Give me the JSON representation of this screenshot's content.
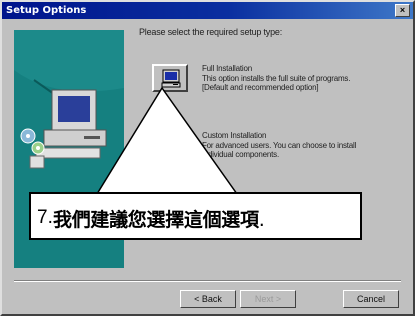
{
  "window": {
    "title": "Setup Options",
    "close_glyph": "×"
  },
  "prompt": "Please select the required setup type:",
  "options": [
    {
      "icon": "computer-monitor-icon",
      "title": "Full Installation",
      "line1": "This option installs the full suite of programs.",
      "line2": "[Default and recommended option]"
    },
    {
      "icon": "computer-monitor-icon",
      "title": "Custom Installation",
      "line1": "For advanced users. You can choose to install",
      "line2": "individual components."
    }
  ],
  "note": {
    "number": "7.",
    "text": "我們建議您選擇這個選項",
    "trail": "."
  },
  "buttons": {
    "back": "< Back",
    "next": "Next >",
    "cancel": "Cancel"
  },
  "colors": {
    "title_bar": "#00148c",
    "art_panel": "#1c8a8a"
  }
}
